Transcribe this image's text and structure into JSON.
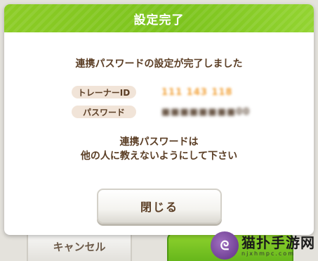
{
  "background": {
    "cancel_label": "キャンセル"
  },
  "dialog": {
    "title": "設定完了",
    "message": "連携パスワードの設定が完了しました",
    "fields": [
      {
        "label": "トレーナーID",
        "value": "111 143 118"
      },
      {
        "label": "パスワード",
        "value": "■■■■■■■■00"
      }
    ],
    "note_line1": "連携パスワードは",
    "note_line2": "他の人に教えないようにして下さい",
    "close_label": "閉じる"
  },
  "watermark": {
    "logo_char": "ᘓ",
    "main": "猫扑手游网",
    "sub": "njxhmpc.com"
  },
  "colors": {
    "header_green": "#7bc31c",
    "text_brown": "#5b3e25",
    "id_orange": "#f2a23a"
  }
}
